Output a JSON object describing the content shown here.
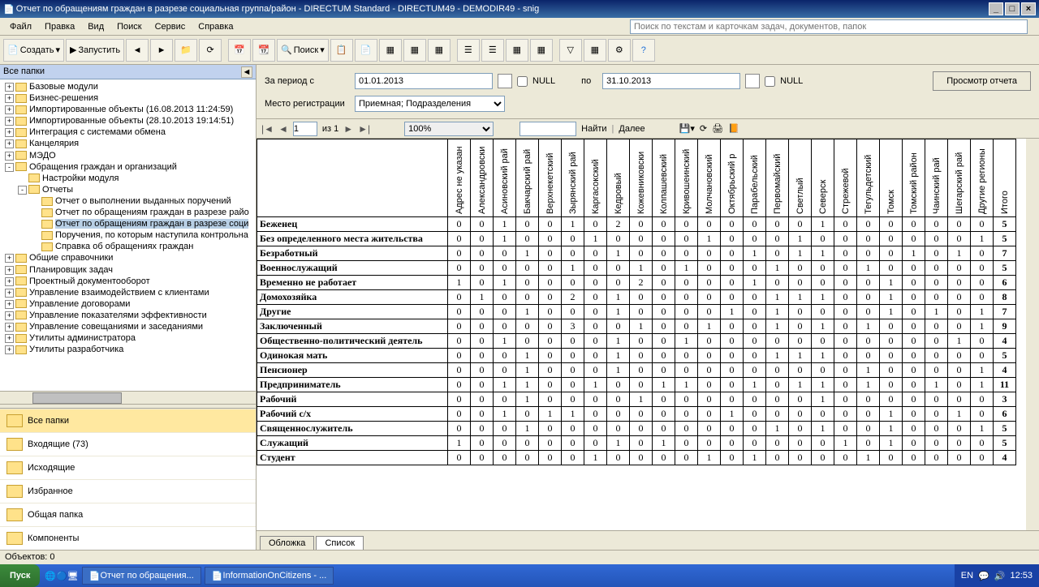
{
  "window_title": "Отчет по обращениям граждан в разрезе социальная группа/район - DIRECTUM Standard - DIRECTUM49 - DEMODIR49 - snig",
  "menubar": [
    "Файл",
    "Правка",
    "Вид",
    "Поиск",
    "Сервис",
    "Справка"
  ],
  "search_placeholder": "Поиск по текстам и карточкам задач, документов, папок",
  "toolbar": {
    "create": "Создать",
    "run": "Запустить",
    "search": "Поиск"
  },
  "left_header": "Все папки",
  "tree": [
    {
      "ind": 0,
      "exp": "+",
      "label": "Базовые модули"
    },
    {
      "ind": 0,
      "exp": "+",
      "label": "Бизнес-решения"
    },
    {
      "ind": 0,
      "exp": "+",
      "label": "Импортированные объекты (16.08.2013 11:24:59)"
    },
    {
      "ind": 0,
      "exp": "+",
      "label": "Импортированные объекты (28.10.2013 19:14:51)"
    },
    {
      "ind": 0,
      "exp": "+",
      "label": "Интеграция с системами обмена"
    },
    {
      "ind": 0,
      "exp": "+",
      "label": "Канцелярия"
    },
    {
      "ind": 0,
      "exp": "+",
      "label": "МЭДО"
    },
    {
      "ind": 0,
      "exp": "-",
      "label": "Обращения граждан и организаций"
    },
    {
      "ind": 1,
      "exp": "",
      "label": "Настройки модуля"
    },
    {
      "ind": 1,
      "exp": "-",
      "label": "Отчеты"
    },
    {
      "ind": 2,
      "exp": "",
      "label": "Отчет о выполнении выданных поручений"
    },
    {
      "ind": 2,
      "exp": "",
      "label": "Отчет по обращениям граждан в разрезе райо"
    },
    {
      "ind": 2,
      "exp": "",
      "label": "Отчет по обращениям граждан в разрезе соци",
      "sel": true
    },
    {
      "ind": 2,
      "exp": "",
      "label": "Поручения, по которым наступила контрольна"
    },
    {
      "ind": 2,
      "exp": "",
      "label": "Справка об обращениях граждан"
    },
    {
      "ind": 0,
      "exp": "+",
      "label": "Общие справочники"
    },
    {
      "ind": 0,
      "exp": "+",
      "label": "Планировщик задач"
    },
    {
      "ind": 0,
      "exp": "+",
      "label": "Проектный документооборот"
    },
    {
      "ind": 0,
      "exp": "+",
      "label": "Управление взаимодействием с клиентами"
    },
    {
      "ind": 0,
      "exp": "+",
      "label": "Управление договорами"
    },
    {
      "ind": 0,
      "exp": "+",
      "label": "Управление показателями эффективности"
    },
    {
      "ind": 0,
      "exp": "+",
      "label": "Управление совещаниями и заседаниями"
    },
    {
      "ind": 0,
      "exp": "+",
      "label": "Утилиты администратора"
    },
    {
      "ind": 0,
      "exp": "+",
      "label": "Утилиты разработчика"
    }
  ],
  "nav": [
    {
      "label": "Все папки",
      "active": true
    },
    {
      "label": "Входящие (73)"
    },
    {
      "label": "Исходящие"
    },
    {
      "label": "Избранное"
    },
    {
      "label": "Общая папка"
    },
    {
      "label": "Компоненты"
    }
  ],
  "params": {
    "period_label": "За период с",
    "from": "01.01.2013",
    "to_label": "по",
    "to": "31.10.2013",
    "null": "NULL",
    "place_label": "Место регистрации",
    "place": "Приемная; Подразделения",
    "view_btn": "Просмотр отчета"
  },
  "viewer": {
    "page": "1",
    "of": "из 1",
    "zoom": "100%",
    "find": "Найти",
    "next": "Далее"
  },
  "columns": [
    "Адрес не указан",
    "Александровски",
    "Асиновский рай",
    "Бакчарский рай",
    "Верхнекетский",
    "Зырянский рай",
    "Каргасокский",
    "Кедровый",
    "Кожевниковски",
    "Колпашевский",
    "Кривошеинский",
    "Молчановский",
    "Октябрьский р",
    "Парабельский",
    "Первомайский",
    "Светлый",
    "Северск",
    "Стрежевой",
    "Тегульдетский",
    "Томск",
    "Томский район",
    "Чаинский рай",
    "Шегарский рай",
    "Другие регионы",
    "Итого"
  ],
  "rows": [
    {
      "name": "Беженец",
      "v": [
        0,
        0,
        1,
        0,
        0,
        1,
        0,
        2,
        0,
        0,
        0,
        0,
        0,
        0,
        0,
        0,
        1,
        0,
        0,
        0,
        0,
        0,
        0,
        0,
        5
      ]
    },
    {
      "name": "Без определенного места жительства",
      "v": [
        0,
        0,
        1,
        0,
        0,
        0,
        1,
        0,
        0,
        0,
        0,
        1,
        0,
        0,
        0,
        1,
        0,
        0,
        0,
        0,
        0,
        0,
        0,
        1,
        5
      ]
    },
    {
      "name": "Безработный",
      "v": [
        0,
        0,
        0,
        1,
        0,
        0,
        0,
        1,
        0,
        0,
        0,
        0,
        0,
        1,
        0,
        1,
        1,
        0,
        0,
        0,
        1,
        0,
        1,
        0,
        7
      ]
    },
    {
      "name": "Военнослужащий",
      "v": [
        0,
        0,
        0,
        0,
        0,
        1,
        0,
        0,
        1,
        0,
        1,
        0,
        0,
        0,
        1,
        0,
        0,
        0,
        1,
        0,
        0,
        0,
        0,
        0,
        5
      ]
    },
    {
      "name": "Временно не работает",
      "v": [
        1,
        0,
        1,
        0,
        0,
        0,
        0,
        0,
        2,
        0,
        0,
        0,
        0,
        1,
        0,
        0,
        0,
        0,
        0,
        1,
        0,
        0,
        0,
        0,
        6
      ]
    },
    {
      "name": "Домохозяйка",
      "v": [
        0,
        1,
        0,
        0,
        0,
        2,
        0,
        1,
        0,
        0,
        0,
        0,
        0,
        0,
        1,
        1,
        1,
        0,
        0,
        1,
        0,
        0,
        0,
        0,
        8
      ]
    },
    {
      "name": "Другие",
      "v": [
        0,
        0,
        0,
        1,
        0,
        0,
        0,
        1,
        0,
        0,
        0,
        0,
        1,
        0,
        1,
        0,
        0,
        0,
        0,
        1,
        0,
        1,
        0,
        1,
        7
      ]
    },
    {
      "name": "Заключенный",
      "v": [
        0,
        0,
        0,
        0,
        0,
        3,
        0,
        0,
        1,
        0,
        0,
        1,
        0,
        0,
        1,
        0,
        1,
        0,
        1,
        0,
        0,
        0,
        0,
        1,
        9
      ]
    },
    {
      "name": "Общественно-политический деятель",
      "v": [
        0,
        0,
        1,
        0,
        0,
        0,
        0,
        1,
        0,
        0,
        1,
        0,
        0,
        0,
        0,
        0,
        0,
        0,
        0,
        0,
        0,
        0,
        1,
        0,
        4
      ]
    },
    {
      "name": "Одинокая мать",
      "v": [
        0,
        0,
        0,
        1,
        0,
        0,
        0,
        1,
        0,
        0,
        0,
        0,
        0,
        0,
        1,
        1,
        1,
        0,
        0,
        0,
        0,
        0,
        0,
        0,
        5
      ]
    },
    {
      "name": "Пенсионер",
      "v": [
        0,
        0,
        0,
        1,
        0,
        0,
        0,
        1,
        0,
        0,
        0,
        0,
        0,
        0,
        0,
        0,
        0,
        0,
        1,
        0,
        0,
        0,
        0,
        1,
        4
      ]
    },
    {
      "name": "Предприниматель",
      "v": [
        0,
        0,
        1,
        1,
        0,
        0,
        1,
        0,
        0,
        1,
        1,
        0,
        0,
        1,
        0,
        1,
        1,
        0,
        1,
        0,
        0,
        1,
        0,
        1,
        11
      ]
    },
    {
      "name": "Рабочий",
      "v": [
        0,
        0,
        0,
        1,
        0,
        0,
        0,
        0,
        1,
        0,
        0,
        0,
        0,
        0,
        0,
        0,
        1,
        0,
        0,
        0,
        0,
        0,
        0,
        0,
        3
      ]
    },
    {
      "name": "Рабочий с/х",
      "v": [
        0,
        0,
        1,
        0,
        1,
        1,
        0,
        0,
        0,
        0,
        0,
        0,
        1,
        0,
        0,
        0,
        0,
        0,
        0,
        1,
        0,
        0,
        1,
        0,
        6
      ]
    },
    {
      "name": "Священнослужитель",
      "v": [
        0,
        0,
        0,
        1,
        0,
        0,
        0,
        0,
        0,
        0,
        0,
        0,
        0,
        0,
        1,
        0,
        1,
        0,
        0,
        1,
        0,
        0,
        0,
        1,
        5
      ]
    },
    {
      "name": "Служащий",
      "v": [
        1,
        0,
        0,
        0,
        0,
        0,
        0,
        1,
        0,
        1,
        0,
        0,
        0,
        0,
        0,
        0,
        0,
        1,
        0,
        1,
        0,
        0,
        0,
        0,
        5
      ]
    },
    {
      "name": "Студент",
      "v": [
        0,
        0,
        0,
        0,
        0,
        0,
        1,
        0,
        0,
        0,
        0,
        1,
        0,
        1,
        0,
        0,
        0,
        0,
        1,
        0,
        0,
        0,
        0,
        0,
        4
      ]
    }
  ],
  "tabs": {
    "cover": "Обложка",
    "list": "Список"
  },
  "status": "Объектов: 0",
  "taskbar": {
    "start": "Пуск",
    "items": [
      "Отчет по обращения...",
      "InformationOnCitizens - ..."
    ],
    "lang": "EN",
    "time": "12:53"
  }
}
